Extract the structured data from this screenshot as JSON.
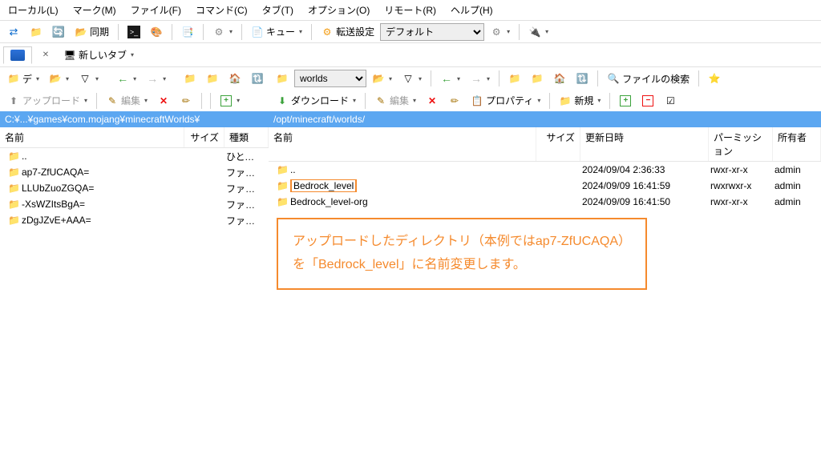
{
  "menu": {
    "local": "ローカル(L)",
    "mark": "マーク(M)",
    "file": "ファイル(F)",
    "command": "コマンド(C)",
    "tab": "タブ(T)",
    "options": "オプション(O)",
    "remote": "リモート(R)",
    "help": "ヘルプ(H)"
  },
  "toolbar1": {
    "sync_label": "同期",
    "queue_label": "キュー",
    "transfer_label": "転送設定",
    "transfer_default_value": "デフォルト"
  },
  "tabs": {
    "newtab_label": "新しいタブ"
  },
  "leftnav": {
    "folder_label": "デ"
  },
  "rightnav": {
    "folder_label": "worlds",
    "find_label": "ファイルの検索"
  },
  "leftact": {
    "upload": "アップロード",
    "edit": "編集"
  },
  "rightact": {
    "download": "ダウンロード",
    "edit": "編集",
    "properties": "プロパティ",
    "newitem": "新規"
  },
  "leftpath": "C:¥...¥games¥com.mojang¥minecraftWorlds¥",
  "rightpath": "/opt/minecraft/worlds/",
  "leftcols": {
    "name": "名前",
    "size": "サイズ",
    "type": "種類"
  },
  "rightcols": {
    "name": "名前",
    "size": "サイズ",
    "date": "更新日時",
    "perm": "パーミッション",
    "owner": "所有者"
  },
  "leftrows": [
    {
      "name": "..",
      "icon": "up",
      "size": "",
      "type": "ひとつ上"
    },
    {
      "name": "ap7-ZfUCAQA=",
      "icon": "folder",
      "size": "",
      "type": "ファイル"
    },
    {
      "name": "LLUbZuoZGQA=",
      "icon": "folder",
      "size": "",
      "type": "ファイル"
    },
    {
      "name": "-XsWZItsBgA=",
      "icon": "folder",
      "size": "",
      "type": "ファイル"
    },
    {
      "name": "zDgJZvE+AAA=",
      "icon": "folder",
      "size": "",
      "type": "ファイル"
    }
  ],
  "rightrows": [
    {
      "name": "..",
      "icon": "up",
      "size": "",
      "date": "2024/09/04 2:36:33",
      "perm": "rwxr-xr-x",
      "owner": "admin"
    },
    {
      "name": "Bedrock_level",
      "icon": "folder",
      "rename": true,
      "size": "",
      "date": "2024/09/09 16:41:59",
      "perm": "rwxrwxr-x",
      "owner": "admin"
    },
    {
      "name": "Bedrock_level-org",
      "icon": "folder",
      "size": "",
      "date": "2024/09/09 16:41:50",
      "perm": "rwxr-xr-x",
      "owner": "admin"
    }
  ],
  "callout_line1": "アップロードしたディレクトリ（本例ではap7-ZfUCAQA）",
  "callout_line2": "を「Bedrock_level」に名前変更します。"
}
